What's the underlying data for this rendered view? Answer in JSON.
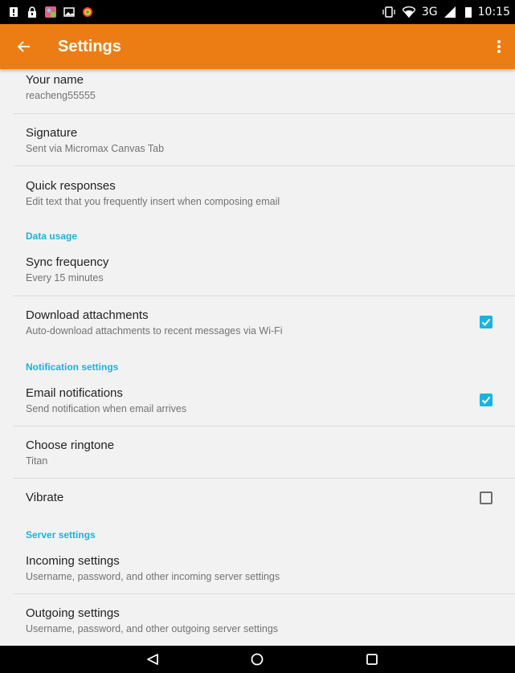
{
  "status_bar": {
    "network": "3G",
    "time": "10:15",
    "left_icons": [
      "sim-alert-icon",
      "lock-icon",
      "gallery-icon",
      "image-icon",
      "app-icon"
    ],
    "right_icons": [
      "vibrate-icon",
      "wifi-icon",
      "signal-icon",
      "battery-icon"
    ]
  },
  "app_bar": {
    "title": "Settings",
    "back_icon": "arrow-left-icon",
    "overflow_icon": "more-vert-icon",
    "color": "#ec7d14"
  },
  "settings": {
    "your_name": {
      "title": "Your name",
      "summary": "reacheng55555"
    },
    "signature": {
      "title": "Signature",
      "summary": "Sent via Micromax Canvas Tab"
    },
    "quick_responses": {
      "title": "Quick responses",
      "summary": "Edit text that you frequently insert when composing email"
    },
    "data_usage_header": "Data usage",
    "sync_frequency": {
      "title": "Sync frequency",
      "summary": "Every 15 minutes"
    },
    "download_attachments": {
      "title": "Download attachments",
      "summary": "Auto-download attachments to recent messages via Wi-Fi",
      "checked": true
    },
    "notification_header": "Notification settings",
    "email_notifications": {
      "title": "Email notifications",
      "summary": "Send notification when email arrives",
      "checked": true
    },
    "choose_ringtone": {
      "title": "Choose ringtone",
      "summary": "Titan"
    },
    "vibrate": {
      "title": "Vibrate",
      "checked": false
    },
    "server_header": "Server settings",
    "incoming_settings": {
      "title": "Incoming settings",
      "summary": "Username, password, and other incoming server settings"
    },
    "outgoing_settings": {
      "title": "Outgoing settings",
      "summary": "Username, password, and other outgoing server settings"
    }
  },
  "accent_color": "#1bb3dc",
  "nav_bar": {
    "icons": [
      "back-triangle-icon",
      "home-circle-icon",
      "recents-square-icon"
    ]
  }
}
